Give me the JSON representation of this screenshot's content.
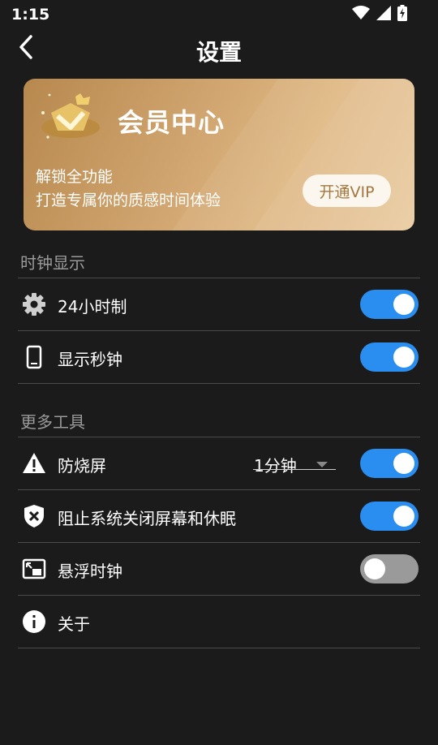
{
  "status_bar": {
    "time": "1:15",
    "icons": [
      "wifi-icon",
      "signal-icon",
      "battery-charging-icon"
    ]
  },
  "header": {
    "title": "设置",
    "back_icon": "chevron-left-icon"
  },
  "vip_card": {
    "title": "会员中心",
    "line1": "解锁全功能",
    "line2": "打造专属你的质感时间体验",
    "button_label": "开通VIP",
    "emblem_icon": "vip-crown-badge-icon",
    "colors": {
      "gradient_start": "#b7894f",
      "gradient_end": "#e9c89c",
      "button_text": "#a27840"
    }
  },
  "sections": [
    {
      "title": "时钟显示",
      "items": [
        {
          "label": "24小时制",
          "icon": "gear-icon",
          "toggle": true
        },
        {
          "label": "显示秒钟",
          "icon": "phone-icon",
          "toggle": true
        }
      ]
    },
    {
      "title": "更多工具",
      "items": [
        {
          "label": "防烧屏",
          "icon": "warning-icon",
          "toggle": true,
          "dropdown_value": "1分钟"
        },
        {
          "label": "阻止系统关闭屏幕和休眠",
          "icon": "shield-x-icon",
          "toggle": true
        },
        {
          "label": "悬浮时钟",
          "icon": "picture-in-picture-icon",
          "toggle": false
        },
        {
          "label": "关于",
          "icon": "info-icon"
        }
      ]
    }
  ],
  "colors": {
    "background": "#1b1b1b",
    "accent": "#2a8ef0",
    "toggle_off": "#9a9a9a",
    "divider": "#4a4a4a",
    "section_text": "#9a9a9a"
  }
}
